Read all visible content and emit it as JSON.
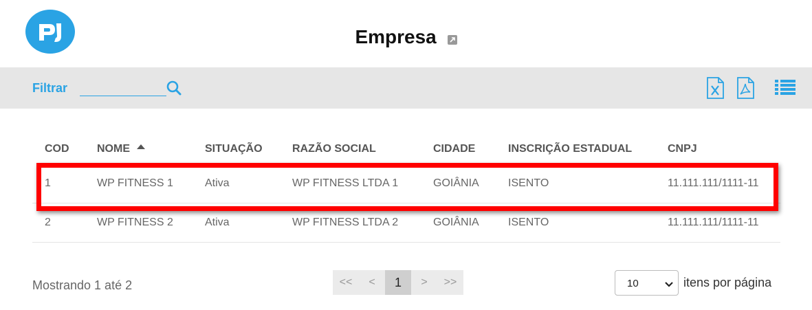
{
  "header": {
    "title": "Empresa",
    "logo_icon": "pj-logo",
    "external_link_icon": "external-link-icon"
  },
  "toolbar": {
    "filter_label": "Filtrar",
    "filter_value": "",
    "search_icon": "search-icon",
    "export_excel_icon": "excel-icon",
    "export_pdf_icon": "pdf-icon",
    "view_list_icon": "list-icon"
  },
  "table": {
    "columns": [
      "COD",
      "NOME",
      "SITUAÇÃO",
      "RAZÃO SOCIAL",
      "CIDADE",
      "INSCRIÇÃO ESTADUAL",
      "CNPJ"
    ],
    "sorted_column": "NOME",
    "sort_direction": "ascending",
    "rows": [
      [
        "1",
        "WP FITNESS 1",
        "Ativa",
        "WP FITNESS LTDA 1",
        "GOIÂNIA",
        "ISENTO",
        "11.111.111/1111-11"
      ],
      [
        "2",
        "WP FITNESS 2",
        "Ativa",
        "WP FITNESS LTDA 2",
        "GOIÂNIA",
        "ISENTO",
        "11.111.111/1111-11"
      ]
    ],
    "highlighted_row": 1
  },
  "footer": {
    "showing": "Mostrando 1 até 2",
    "pagination": {
      "first": "<<",
      "prev": "<",
      "current": "1",
      "next": ">",
      "last": ">>"
    },
    "per_page": {
      "selected": "10",
      "label": "itens por página"
    }
  },
  "colors": {
    "accent": "#2aa3e4",
    "highlight": "#ff0000",
    "toolbar_bg": "#e6e6e6"
  }
}
